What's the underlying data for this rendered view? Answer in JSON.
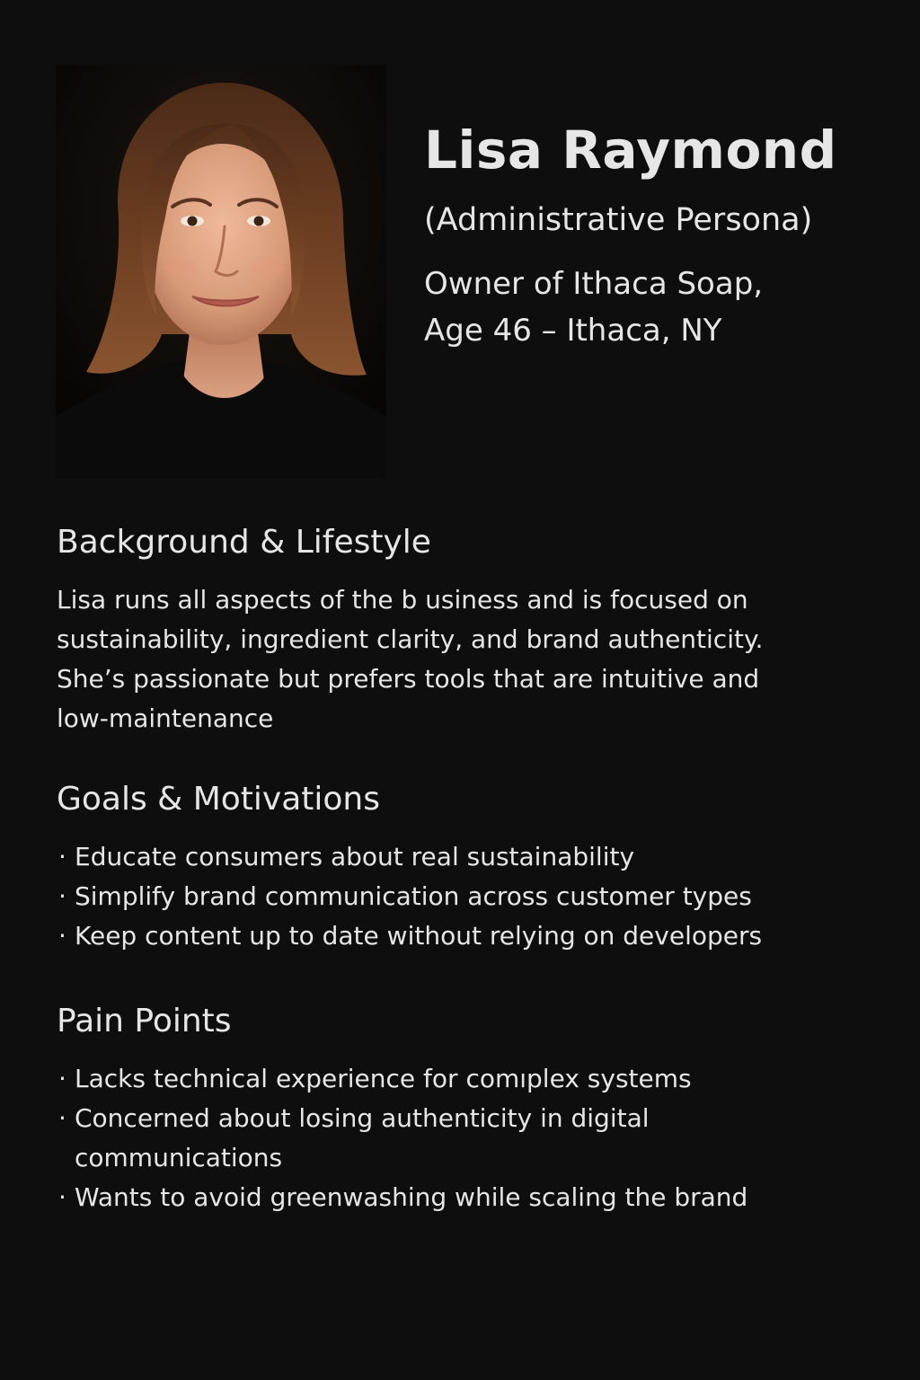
{
  "persona": {
    "name": "Lisa Raymond",
    "type": "(Administrative Persona)",
    "role_line_1": "Owner of Ithaca Soap,",
    "role_line_2": "Age 46 – Ithaca, NY"
  },
  "background": {
    "title": "Background & Lifestyle",
    "lines": [
      "Lisa runs all aspects of the b usiness and is focused on",
      "sustainability, ingredient clarity, and brand authenticity.",
      "She’s passionate but prefers tools that are intuitive and",
      "low-maintenance"
    ]
  },
  "goals": {
    "title": "Goals & Motivations",
    "bullet": "·",
    "items": [
      "Educate consumers about real sustainability",
      "Simplify brand communication across customer types",
      "Keep content up to date without relying on developers"
    ]
  },
  "pain_points": {
    "title": "Pain Points",
    "bullet": "·",
    "items": [
      [
        "Lacks technical experience for comıplex systems"
      ],
      [
        "Concerned about losing authenticity in digital",
        "communications"
      ],
      [
        "Wants to avoid greenwashing while scaling the brand"
      ]
    ]
  },
  "colors": {
    "background": "#0e0e0e",
    "text": "#e6e6e6",
    "hair": "#6e3f22",
    "skin": "#e0a585",
    "shirt": "#0b0b0b"
  }
}
